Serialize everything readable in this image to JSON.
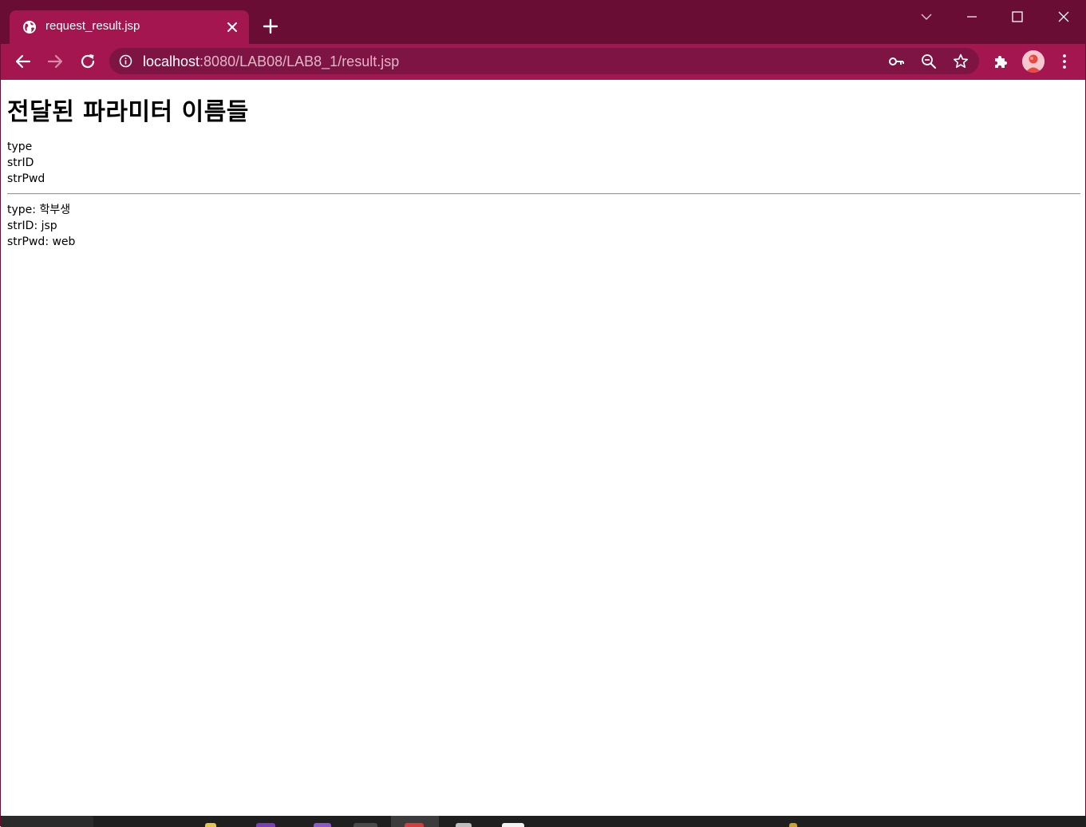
{
  "tab": {
    "title": "request_result.jsp"
  },
  "address_bar": {
    "host": "localhost",
    "path": ":8080/LAB08/LAB8_1/result.jsp"
  },
  "page": {
    "heading": "전달된 파라미터 이름들",
    "param_names": [
      "type",
      "strID",
      "strPwd"
    ],
    "param_values": [
      "type: 학부생",
      "strID: jsp",
      "strPwd: web"
    ]
  },
  "theme": {
    "frame_color": "#6a0d35",
    "toolbar_color": "#a3164f",
    "omnibox_color": "#7e1443"
  },
  "icons": {
    "tab_favicon": "globe-icon",
    "tab_close": "close-icon",
    "new_tab": "plus-icon",
    "tab_search": "chevron-down-icon",
    "minimize": "minimize-icon",
    "maximize": "maximize-icon",
    "close_window": "close-icon",
    "back": "arrow-left-icon",
    "forward": "arrow-right-icon",
    "reload": "reload-icon",
    "site_info": "info-icon",
    "password": "key-icon",
    "zoom": "zoom-out-icon",
    "bookmark": "star-icon",
    "extensions": "puzzle-icon",
    "profile": "avatar",
    "menu": "kebab-menu-icon"
  }
}
